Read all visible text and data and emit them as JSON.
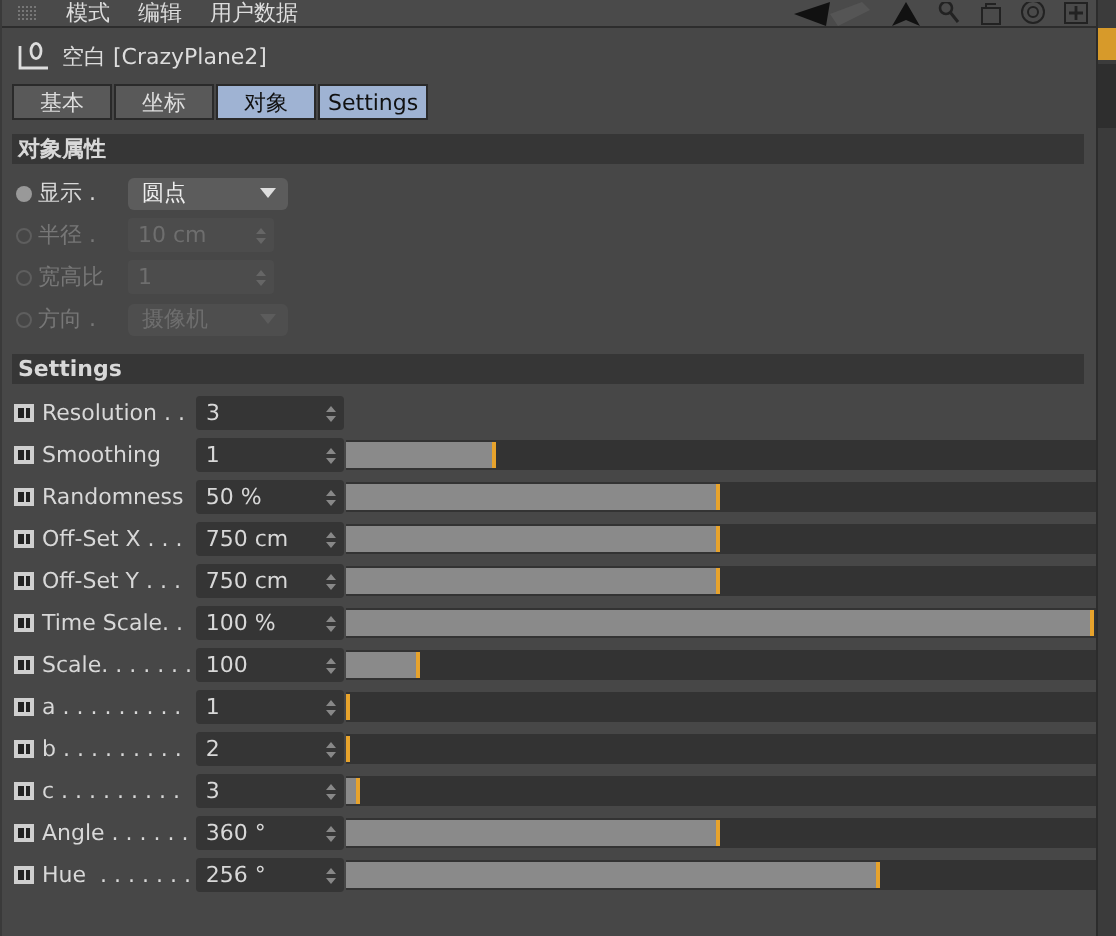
{
  "menu": [
    "模式",
    "编辑",
    "用户数据"
  ],
  "object": {
    "title": "空白 [CrazyPlane2]"
  },
  "tabs": [
    {
      "label": "基本",
      "selected": false
    },
    {
      "label": "坐标",
      "selected": false
    },
    {
      "label": "对象",
      "selected": true
    },
    {
      "label": "Settings",
      "selected": true
    }
  ],
  "object_properties": {
    "title": "对象属性",
    "rows": [
      {
        "label": "显示",
        "dots": " .",
        "kind": "dropdown",
        "value": "圆点",
        "disabled": false
      },
      {
        "label": "半径",
        "dots": " .",
        "kind": "number",
        "value": "10 cm",
        "disabled": true
      },
      {
        "label": "宽高比",
        "dots": "",
        "kind": "number",
        "value": "1",
        "disabled": true
      },
      {
        "label": "方向",
        "dots": " .",
        "kind": "dropdown",
        "value": "摄像机",
        "disabled": true
      }
    ]
  },
  "settings": {
    "title": "Settings",
    "rows": [
      {
        "label": "Resolution . .",
        "kind": "number",
        "value": "3"
      },
      {
        "label": "Smoothing",
        "kind": "slider",
        "value": "1",
        "level": 0.2
      },
      {
        "label": "Randomness",
        "kind": "slider",
        "value": "50 %",
        "level": 0.5
      },
      {
        "label": "Off-Set X . . .",
        "kind": "slider",
        "value": "750 cm",
        "level": 0.5
      },
      {
        "label": "Off-Set Y . . .",
        "kind": "slider",
        "value": "750 cm",
        "level": 0.5
      },
      {
        "label": "Time Scale. .",
        "kind": "slider",
        "value": "100 %",
        "level": 1
      },
      {
        "label": "Scale. . . . . . .",
        "kind": "slider",
        "value": "100",
        "level": 0.1
      },
      {
        "label": "a . . . . . . . . .",
        "kind": "slider",
        "value": "1",
        "level": 0
      },
      {
        "label": "b . . . . . . . . .",
        "kind": "slider",
        "value": "2",
        "level": 0
      },
      {
        "label": "c . . . . . . . . .",
        "kind": "slider",
        "value": "3",
        "level": 0.02
      },
      {
        "label": "Angle . . . . . .",
        "kind": "slider",
        "value": "360 °",
        "level": 0.5
      },
      {
        "label": "Hue  . . . . . . .",
        "kind": "slider",
        "value": "256 °",
        "level": 0.715
      }
    ]
  }
}
